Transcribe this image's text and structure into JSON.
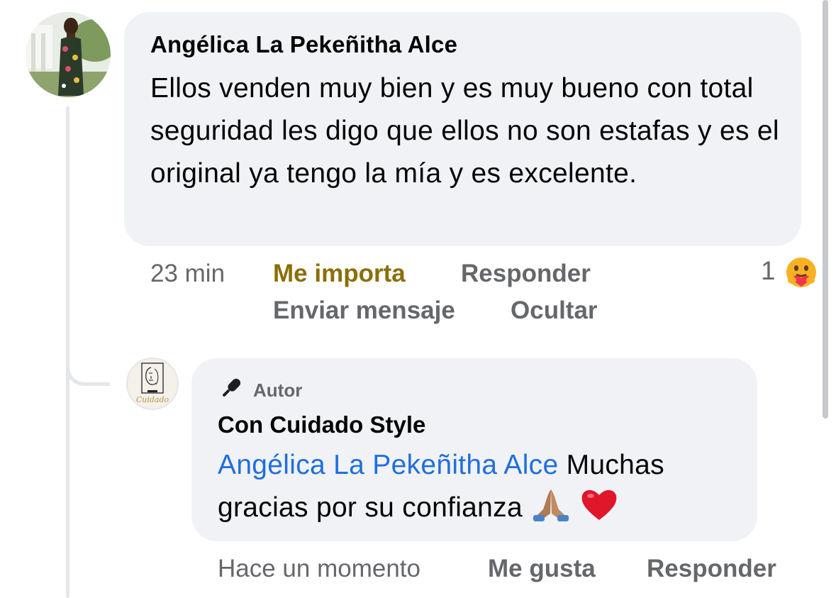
{
  "comment": {
    "author": "Angélica La Pekeñitha Alce",
    "text": "Ellos venden muy bien y es muy bueno con total seguridad les digo que ellos no son estafas y es el original ya tengo la mía y es excelente.",
    "time": "23 min",
    "reaction_action": "Me importa",
    "reply_action": "Responder",
    "message_action": "Enviar mensaje",
    "hide_action": "Ocultar",
    "reaction_count": "1",
    "reaction_icon": "care-reaction-icon",
    "reaction_color": "#8a6f08"
  },
  "reply": {
    "badge_icon": "microphone-icon",
    "badge_label": "Autor",
    "author": "Con Cuidado Style",
    "avatar_logo_text": "Cuidado",
    "mention": "Angélica La Pekeñitha Alce",
    "text": "Muchas gracias por su confianza",
    "emojis": [
      "folded-hands-icon",
      "red-heart-icon"
    ],
    "time": "Hace un momento",
    "like_action": "Me gusta",
    "reply_action": "Responder",
    "mention_color": "#216fdb"
  }
}
